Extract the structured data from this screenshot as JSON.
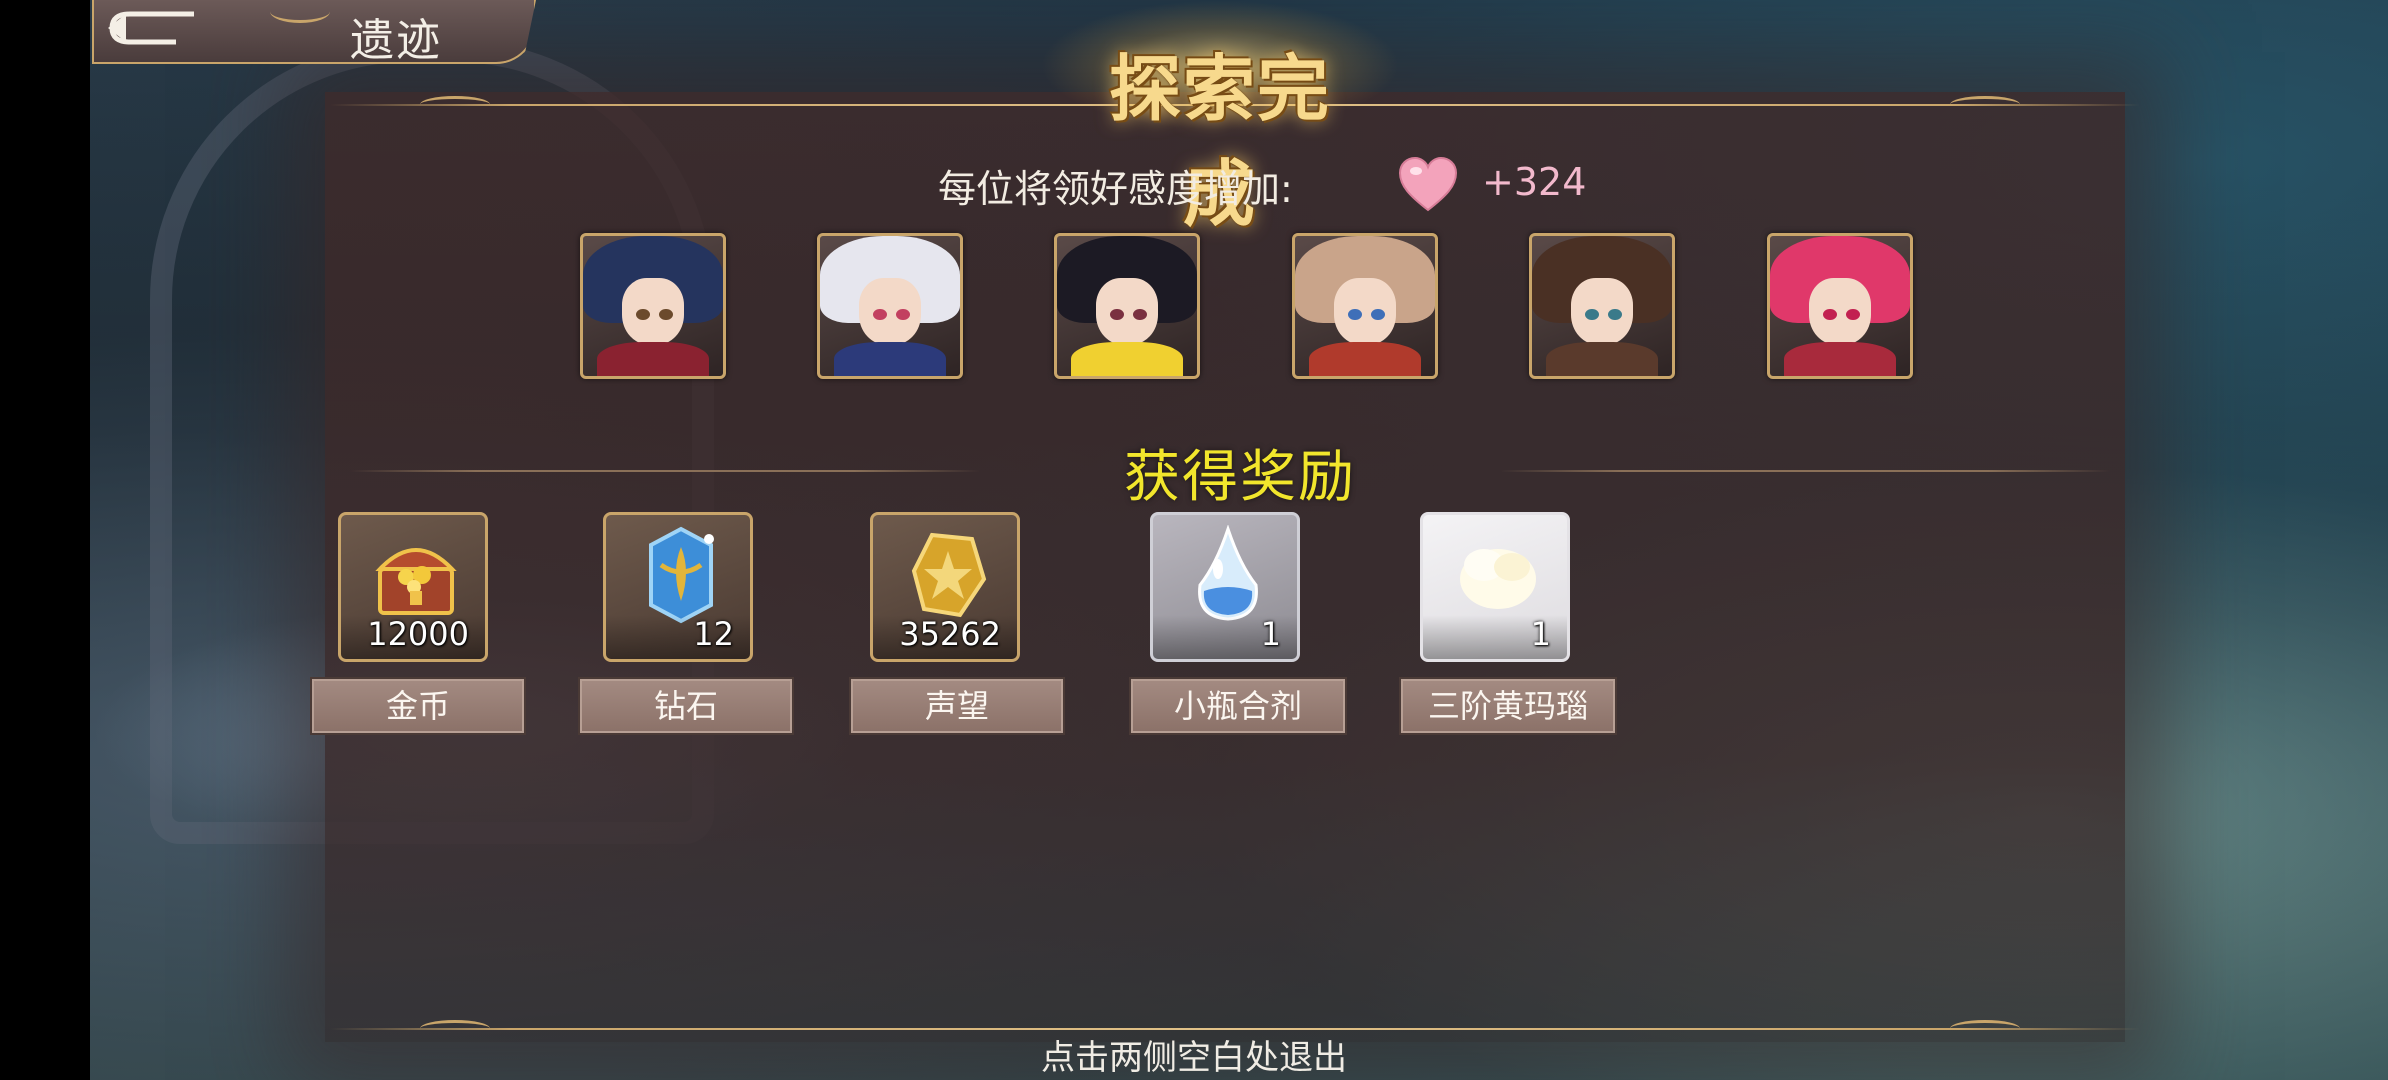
{
  "topbar": {
    "title": "遗迹"
  },
  "header": {
    "title": "探索完成"
  },
  "affection": {
    "label": "每位将领好感度增加:",
    "value": "+324",
    "icon": "heart-icon",
    "color": "#f08fae"
  },
  "portraits": [
    {
      "name": "commander-1",
      "hair": "#25345e",
      "body": "#8a2230",
      "eye": "#6b4a2c"
    },
    {
      "name": "commander-2",
      "hair": "#e6e6ee",
      "body": "#2c3a7a",
      "eye": "#c24060"
    },
    {
      "name": "commander-3",
      "hair": "#1c1a24",
      "body": "#f0d030",
      "eye": "#7a3040"
    },
    {
      "name": "commander-4",
      "hair": "#c9a48a",
      "body": "#b03a2c",
      "eye": "#3f6fb8"
    },
    {
      "name": "commander-5",
      "hair": "#4a3024",
      "body": "#5a3a2c",
      "eye": "#3a7a8a"
    },
    {
      "name": "commander-6",
      "hair": "#e0386a",
      "body": "#a82a3c",
      "eye": "#c22050"
    }
  ],
  "rewards": {
    "title": "获得奖励",
    "items": [
      {
        "label": "金币",
        "count": "12000",
        "icon": "treasure-chest-icon",
        "style": "bronze"
      },
      {
        "label": "钻石",
        "count": "12",
        "icon": "diamond-crystal-icon",
        "style": "bronze"
      },
      {
        "label": "声望",
        "count": "35262",
        "icon": "prestige-medal-icon",
        "style": "bronze"
      },
      {
        "label": "小瓶合剂",
        "count": "1",
        "icon": "potion-bottle-icon",
        "style": "silver"
      },
      {
        "label": "三阶黄玛瑙",
        "count": "1",
        "icon": "agate-stone-icon",
        "style": "white"
      }
    ]
  },
  "footer": {
    "hint": "点击两侧空白处退出"
  }
}
